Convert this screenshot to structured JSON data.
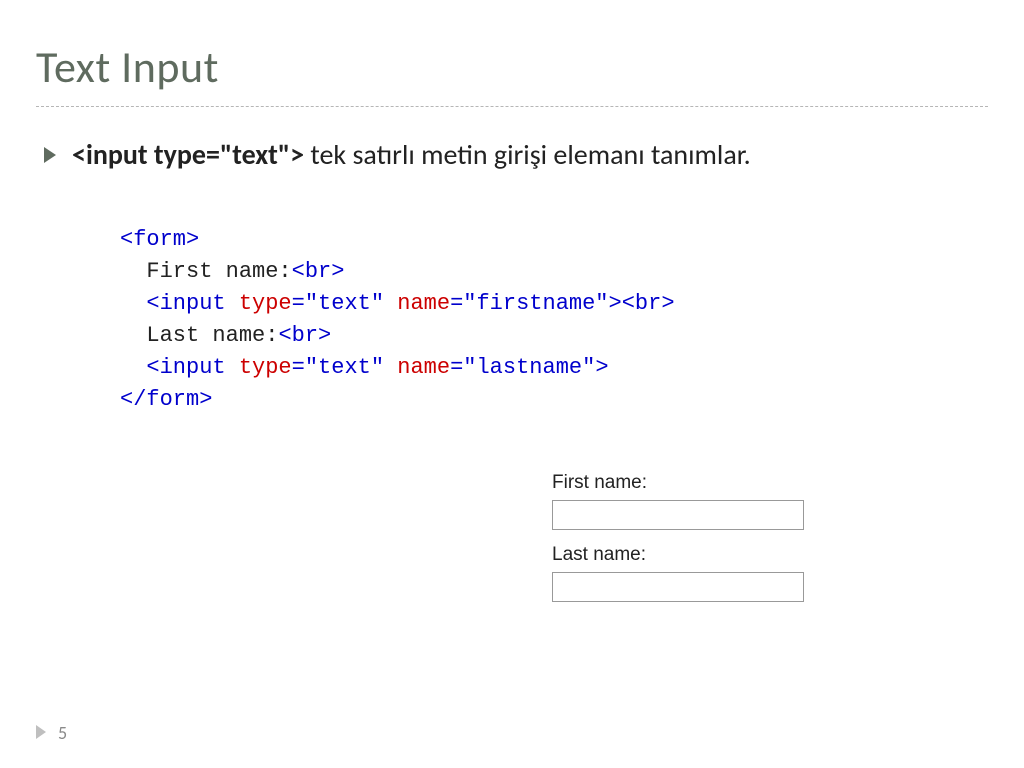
{
  "title": "Text Input",
  "bullet": {
    "code": "<input type=\"text\">",
    "rest": " tek satırlı metin girişi elemanı tanımlar."
  },
  "code": {
    "l1_open": "<form>",
    "l2_txt": "  First name:",
    "l2_br": "<br>",
    "l3_open": "  <input ",
    "l3_a1": "type",
    "l3_eq1": "=",
    "l3_v1": "\"text\"",
    "l3_sp1": " ",
    "l3_a2": "name",
    "l3_eq2": "=",
    "l3_v2": "\"firstname\"",
    "l3_close": ">",
    "l3_br": "<br>",
    "l4_txt": "  Last name:",
    "l4_br": "<br>",
    "l5_open": "  <input ",
    "l5_a1": "type",
    "l5_eq1": "=",
    "l5_v1": "\"text\"",
    "l5_sp1": " ",
    "l5_a2": "name",
    "l5_eq2": "=",
    "l5_v2": "\"lastname\"",
    "l5_close": ">",
    "l6_close": "</form>"
  },
  "preview": {
    "first_label": "First name:",
    "last_label": "Last name:"
  },
  "page_number": "5"
}
